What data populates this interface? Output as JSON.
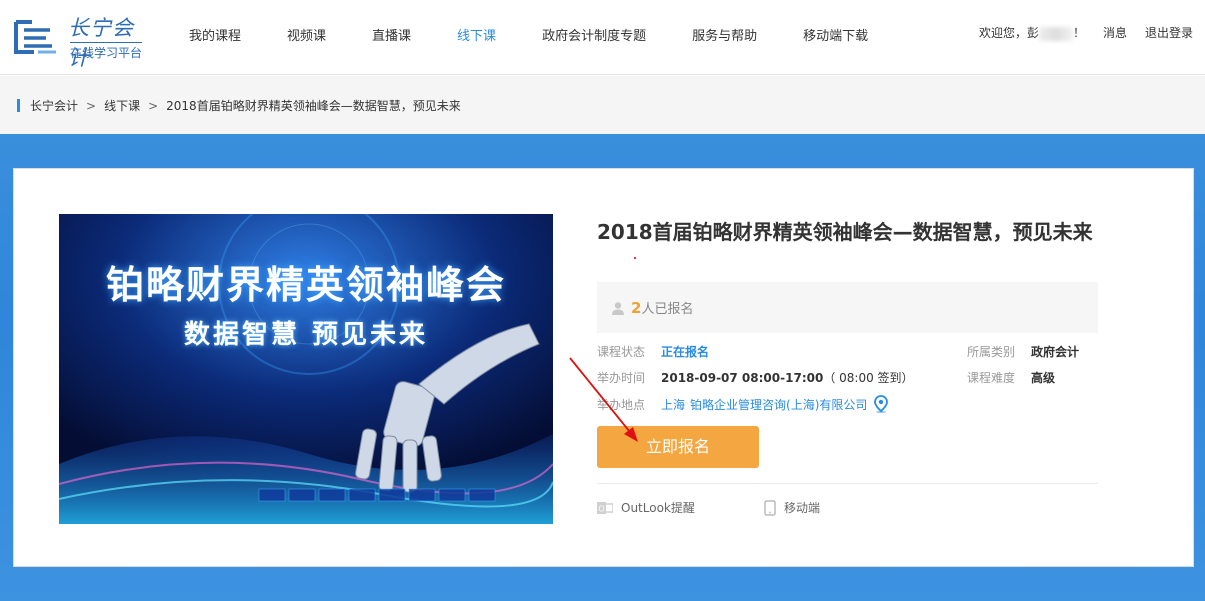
{
  "header": {
    "logo_title": "长宁会计",
    "logo_sub": "在线学习平台",
    "nav": [
      {
        "label": "我的课程",
        "active": false
      },
      {
        "label": "视频课",
        "active": false
      },
      {
        "label": "直播课",
        "active": false
      },
      {
        "label": "线下课",
        "active": true
      },
      {
        "label": "政府会计制度专题",
        "active": false
      },
      {
        "label": "服务与帮助",
        "active": false
      },
      {
        "label": "移动端下载",
        "active": false
      }
    ],
    "welcome": "欢迎您，彭",
    "welcome_end": "！",
    "messages": "消息",
    "logout": "退出登录"
  },
  "breadcrumb": [
    "长宁会计",
    "线下课",
    "2018首届铂略财界精英领袖峰会—数据智慧，预见未来"
  ],
  "breadcrumb_sep": ">",
  "banner": {
    "title": "铂略财界精英领袖峰会",
    "subtitle": "数据智慧 预见未来"
  },
  "course": {
    "title": "2018首届铂略财界精英领袖峰会—数据智慧，预见未来",
    "enrolled_count": "2",
    "enrolled_text": "人已报名",
    "status_label": "课程状态",
    "status_value": "正在报名",
    "time_label": "举办时间",
    "time_value": "2018-09-07 08:00-17:00",
    "time_checkin": "（ 08:00 签到）",
    "location_label": "举办地点",
    "location_city": "上海",
    "location_value": "铂略企业管理咨询(上海)有限公司",
    "category_label": "所属类别",
    "category_value": "政府会计",
    "difficulty_label": "课程难度",
    "difficulty_value": "高级",
    "signup_button": "立即报名",
    "outlook_label": "OutLook提醒",
    "mobile_label": "移动端"
  },
  "colors": {
    "accent_blue": "#2a8ce0",
    "signup_orange": "#f4a641",
    "count_orange": "#f0a030"
  }
}
